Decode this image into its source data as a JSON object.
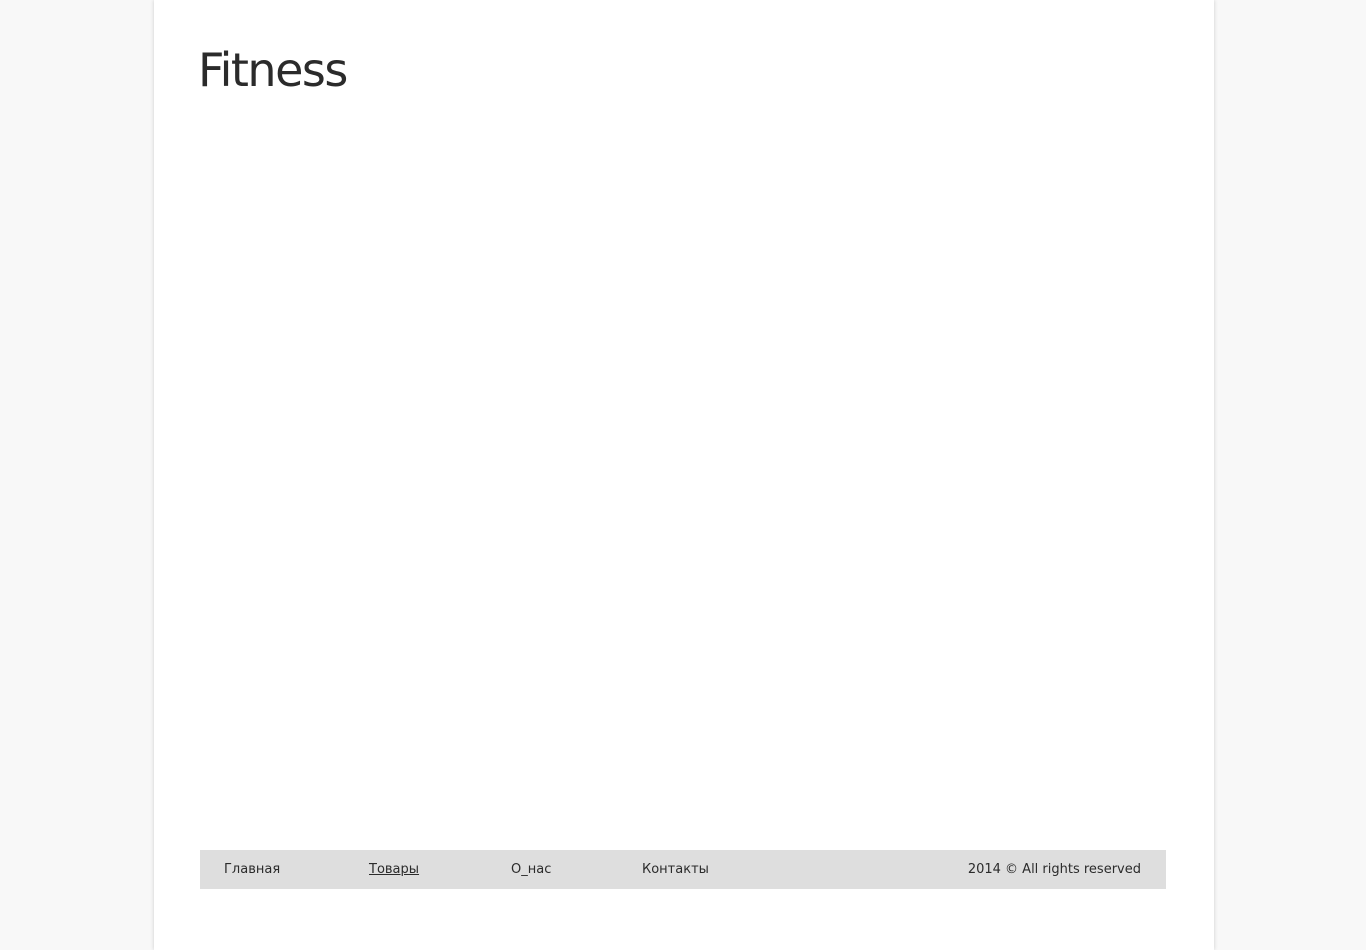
{
  "header": {
    "logo_text": "Fitness"
  },
  "footer": {
    "nav": [
      {
        "label": "Главная",
        "active": false
      },
      {
        "label": "Товары",
        "active": true
      },
      {
        "label": "О_нас",
        "active": false
      },
      {
        "label": "Контакты",
        "active": false
      }
    ],
    "copyright": "2014 © All rights reserved"
  },
  "colors": {
    "background": "#f8f8f8",
    "page": "#ffffff",
    "footer_bar": "#dedede",
    "text": "#2b2b2b"
  }
}
